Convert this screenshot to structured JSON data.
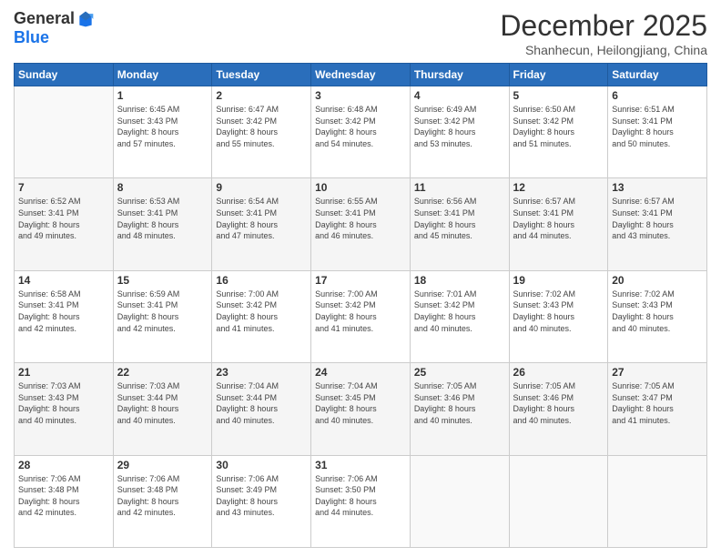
{
  "logo": {
    "general": "General",
    "blue": "Blue"
  },
  "header": {
    "month": "December 2025",
    "location": "Shanhecun, Heilongjiang, China"
  },
  "days_of_week": [
    "Sunday",
    "Monday",
    "Tuesday",
    "Wednesday",
    "Thursday",
    "Friday",
    "Saturday"
  ],
  "weeks": [
    [
      {
        "day": "",
        "info": ""
      },
      {
        "day": "1",
        "info": "Sunrise: 6:45 AM\nSunset: 3:43 PM\nDaylight: 8 hours\nand 57 minutes."
      },
      {
        "day": "2",
        "info": "Sunrise: 6:47 AM\nSunset: 3:42 PM\nDaylight: 8 hours\nand 55 minutes."
      },
      {
        "day": "3",
        "info": "Sunrise: 6:48 AM\nSunset: 3:42 PM\nDaylight: 8 hours\nand 54 minutes."
      },
      {
        "day": "4",
        "info": "Sunrise: 6:49 AM\nSunset: 3:42 PM\nDaylight: 8 hours\nand 53 minutes."
      },
      {
        "day": "5",
        "info": "Sunrise: 6:50 AM\nSunset: 3:42 PM\nDaylight: 8 hours\nand 51 minutes."
      },
      {
        "day": "6",
        "info": "Sunrise: 6:51 AM\nSunset: 3:41 PM\nDaylight: 8 hours\nand 50 minutes."
      }
    ],
    [
      {
        "day": "7",
        "info": "Sunrise: 6:52 AM\nSunset: 3:41 PM\nDaylight: 8 hours\nand 49 minutes."
      },
      {
        "day": "8",
        "info": "Sunrise: 6:53 AM\nSunset: 3:41 PM\nDaylight: 8 hours\nand 48 minutes."
      },
      {
        "day": "9",
        "info": "Sunrise: 6:54 AM\nSunset: 3:41 PM\nDaylight: 8 hours\nand 47 minutes."
      },
      {
        "day": "10",
        "info": "Sunrise: 6:55 AM\nSunset: 3:41 PM\nDaylight: 8 hours\nand 46 minutes."
      },
      {
        "day": "11",
        "info": "Sunrise: 6:56 AM\nSunset: 3:41 PM\nDaylight: 8 hours\nand 45 minutes."
      },
      {
        "day": "12",
        "info": "Sunrise: 6:57 AM\nSunset: 3:41 PM\nDaylight: 8 hours\nand 44 minutes."
      },
      {
        "day": "13",
        "info": "Sunrise: 6:57 AM\nSunset: 3:41 PM\nDaylight: 8 hours\nand 43 minutes."
      }
    ],
    [
      {
        "day": "14",
        "info": "Sunrise: 6:58 AM\nSunset: 3:41 PM\nDaylight: 8 hours\nand 42 minutes."
      },
      {
        "day": "15",
        "info": "Sunrise: 6:59 AM\nSunset: 3:41 PM\nDaylight: 8 hours\nand 42 minutes."
      },
      {
        "day": "16",
        "info": "Sunrise: 7:00 AM\nSunset: 3:42 PM\nDaylight: 8 hours\nand 41 minutes."
      },
      {
        "day": "17",
        "info": "Sunrise: 7:00 AM\nSunset: 3:42 PM\nDaylight: 8 hours\nand 41 minutes."
      },
      {
        "day": "18",
        "info": "Sunrise: 7:01 AM\nSunset: 3:42 PM\nDaylight: 8 hours\nand 40 minutes."
      },
      {
        "day": "19",
        "info": "Sunrise: 7:02 AM\nSunset: 3:43 PM\nDaylight: 8 hours\nand 40 minutes."
      },
      {
        "day": "20",
        "info": "Sunrise: 7:02 AM\nSunset: 3:43 PM\nDaylight: 8 hours\nand 40 minutes."
      }
    ],
    [
      {
        "day": "21",
        "info": "Sunrise: 7:03 AM\nSunset: 3:43 PM\nDaylight: 8 hours\nand 40 minutes."
      },
      {
        "day": "22",
        "info": "Sunrise: 7:03 AM\nSunset: 3:44 PM\nDaylight: 8 hours\nand 40 minutes."
      },
      {
        "day": "23",
        "info": "Sunrise: 7:04 AM\nSunset: 3:44 PM\nDaylight: 8 hours\nand 40 minutes."
      },
      {
        "day": "24",
        "info": "Sunrise: 7:04 AM\nSunset: 3:45 PM\nDaylight: 8 hours\nand 40 minutes."
      },
      {
        "day": "25",
        "info": "Sunrise: 7:05 AM\nSunset: 3:46 PM\nDaylight: 8 hours\nand 40 minutes."
      },
      {
        "day": "26",
        "info": "Sunrise: 7:05 AM\nSunset: 3:46 PM\nDaylight: 8 hours\nand 40 minutes."
      },
      {
        "day": "27",
        "info": "Sunrise: 7:05 AM\nSunset: 3:47 PM\nDaylight: 8 hours\nand 41 minutes."
      }
    ],
    [
      {
        "day": "28",
        "info": "Sunrise: 7:06 AM\nSunset: 3:48 PM\nDaylight: 8 hours\nand 42 minutes."
      },
      {
        "day": "29",
        "info": "Sunrise: 7:06 AM\nSunset: 3:48 PM\nDaylight: 8 hours\nand 42 minutes."
      },
      {
        "day": "30",
        "info": "Sunrise: 7:06 AM\nSunset: 3:49 PM\nDaylight: 8 hours\nand 43 minutes."
      },
      {
        "day": "31",
        "info": "Sunrise: 7:06 AM\nSunset: 3:50 PM\nDaylight: 8 hours\nand 44 minutes."
      },
      {
        "day": "",
        "info": ""
      },
      {
        "day": "",
        "info": ""
      },
      {
        "day": "",
        "info": ""
      }
    ]
  ]
}
